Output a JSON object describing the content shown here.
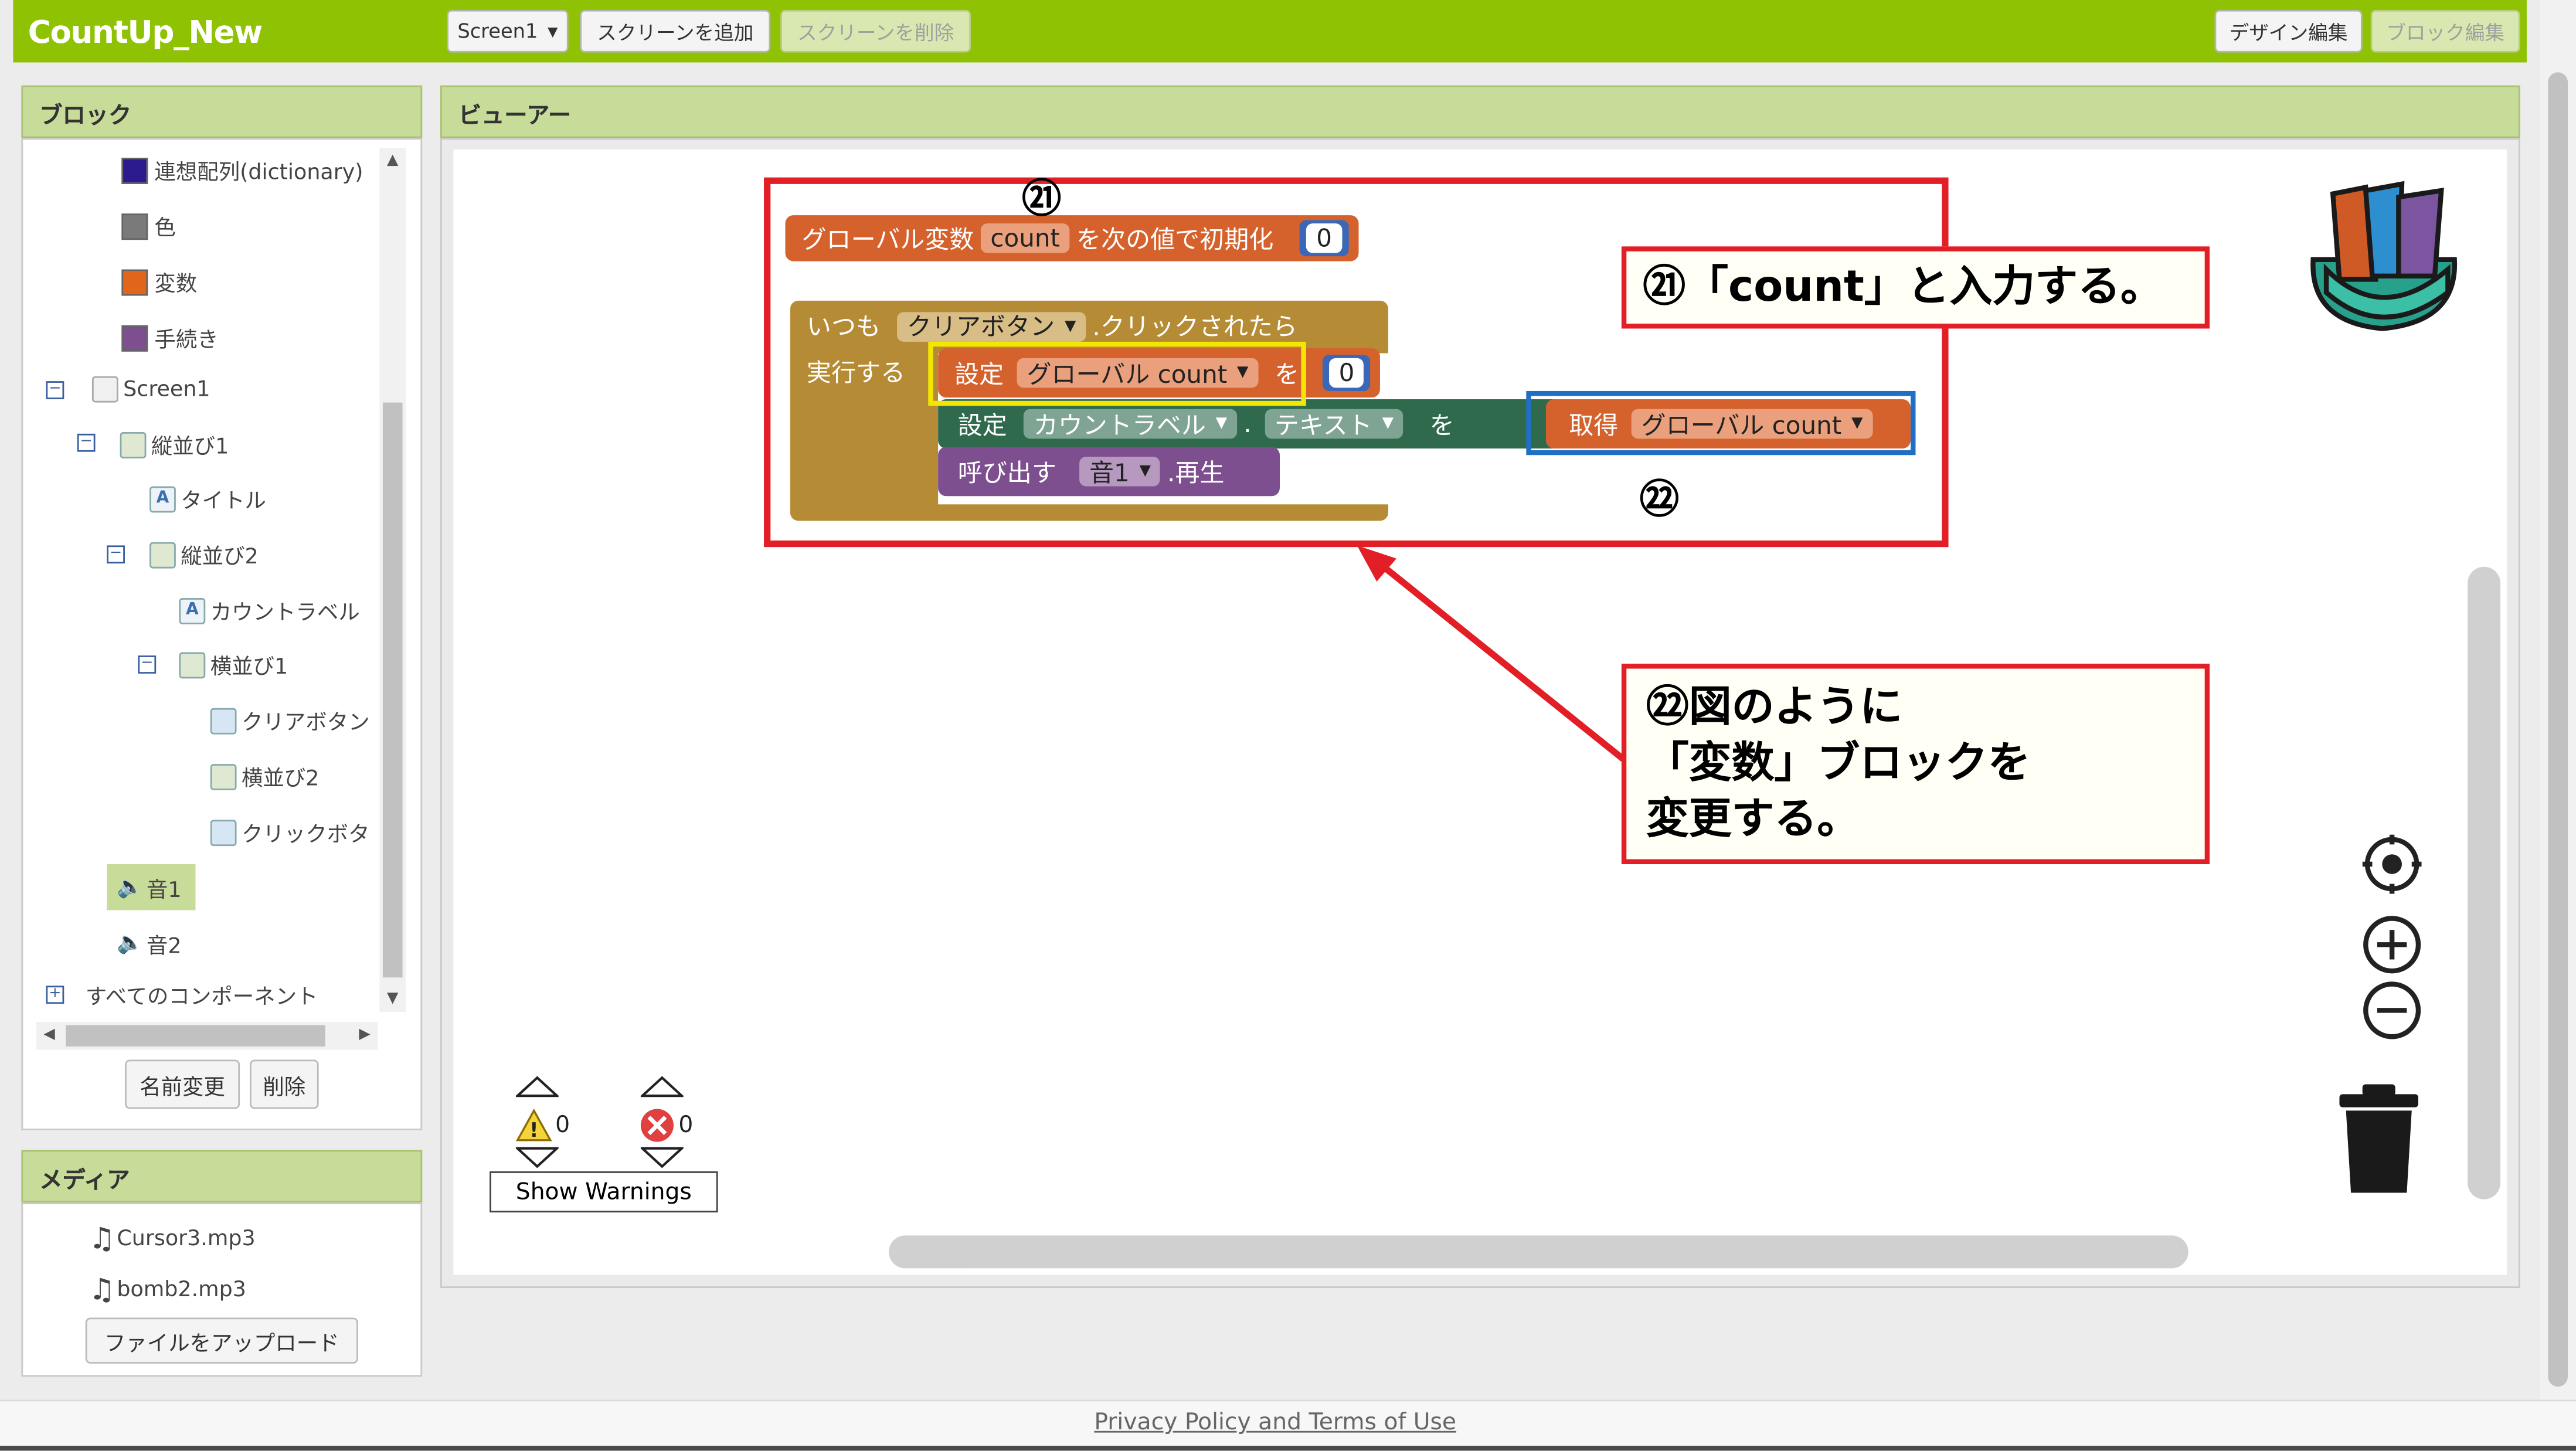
{
  "header": {
    "app_title": "CountUp_New",
    "screen_select": "Screen1",
    "add_screen": "スクリーンを追加",
    "remove_screen": "スクリーンを削除",
    "designer": "デザイン編集",
    "blocks": "ブロック編集"
  },
  "blocks_panel": {
    "title": "ブロック",
    "builtins": [
      {
        "label": "連想配列(dictionary)",
        "color": "#2b1b8f"
      },
      {
        "label": "色",
        "color": "#7a7a7a"
      },
      {
        "label": "変数",
        "color": "#e0671a"
      },
      {
        "label": "手続き",
        "color": "#7e4f8f"
      }
    ],
    "components": {
      "screen": "Screen1",
      "vertical1": "縦並び1",
      "title": "タイトル",
      "vertical2": "縦並び2",
      "count_label": "カウントラベル",
      "horizontal1": "横並び1",
      "clear_button": "クリアボタン",
      "horizontal2": "横並び2",
      "click_button": "クリックボタ",
      "sound1": "音1",
      "sound2": "音2",
      "all_components": "すべてのコンポーネント"
    },
    "rename": "名前変更",
    "delete": "削除"
  },
  "media_panel": {
    "title": "メディア",
    "files": [
      "Cursor3.mp3",
      "bomb2.mp3"
    ],
    "upload": "ファイルをアップロード"
  },
  "viewer": {
    "title": "ビューアー",
    "global_block": {
      "prefix": "グローバル変数",
      "name": "count",
      "suffix": "を次の値で初期化",
      "value": "0"
    },
    "event_block": {
      "when": "いつも",
      "component": "クリアボタン",
      "event": ".クリックされたら",
      "do": "実行する",
      "set_label": "設定",
      "set_var": "グローバル count",
      "to": "を",
      "set_value": "0",
      "set2_label": "設定",
      "set2_component": "カウントラベル",
      "dot": ".",
      "set2_prop": "テキスト",
      "to2": "を",
      "get_label": "取得",
      "get_var": "グローバル count",
      "call_label": "呼び出す",
      "call_component": "音1",
      "call_method": ".再生"
    },
    "warnings": {
      "warning_count": "0",
      "error_count": "0",
      "button": "Show Warnings"
    }
  },
  "annotations": {
    "marker21": "㉑",
    "marker22": "㉒",
    "callout21": "㉑「count」と入力する。",
    "callout22_lines": [
      "㉒図のように",
      "「変数」ブロックを",
      "変更する。"
    ]
  },
  "footer": {
    "link": "Privacy Policy and Terms of Use"
  },
  "colors": {
    "brand": "#8fc202",
    "annotation_red": "#e21f26",
    "highlight_yellow": "#f3e600",
    "highlight_blue": "#1f6fc6"
  }
}
